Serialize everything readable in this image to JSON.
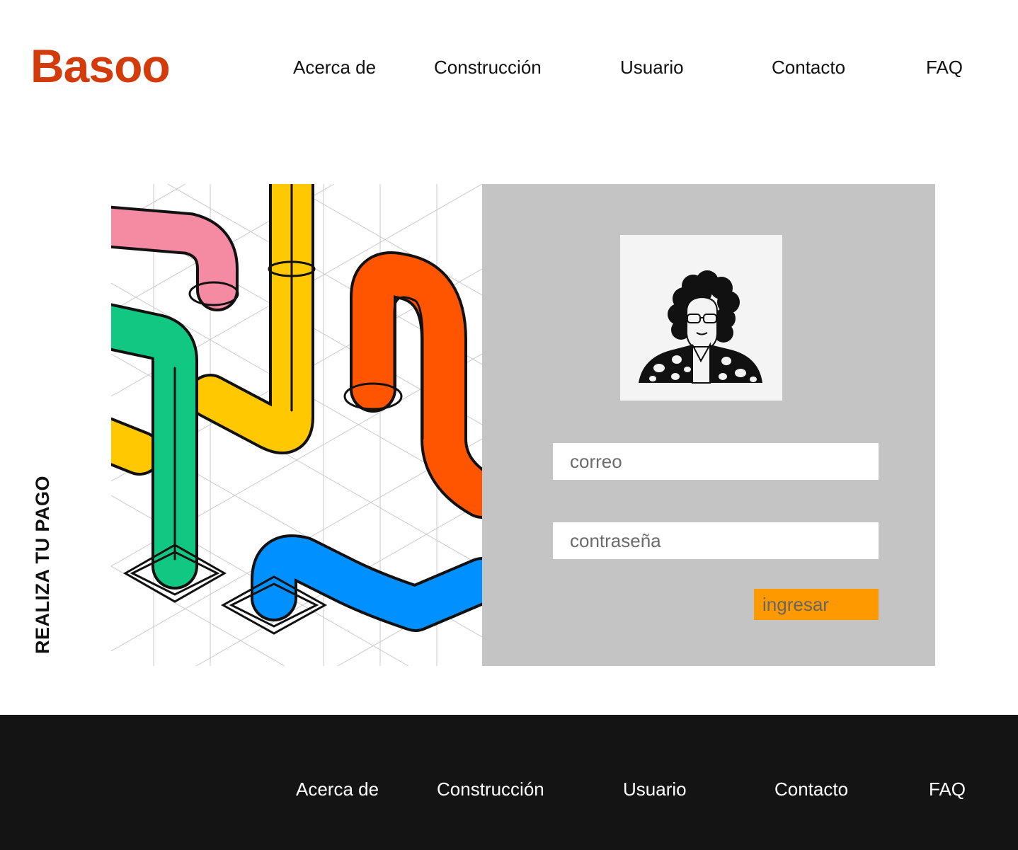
{
  "brand": {
    "name": "Basoo",
    "color": "#d43b0a"
  },
  "nav": {
    "items": [
      {
        "label": "Acerca de"
      },
      {
        "label": "Construcción"
      },
      {
        "label": "Usuario"
      },
      {
        "label": "Contacto"
      },
      {
        "label": "FAQ"
      }
    ]
  },
  "side_title": "REALIZA TU PAGO",
  "illustration": {
    "icon": "colorful-pipes-illustration"
  },
  "login": {
    "avatar_icon": "user-avatar-icon",
    "email_placeholder": "correo",
    "password_placeholder": "contraseña",
    "submit_label": "ingresar",
    "submit_color": "#ff9900",
    "panel_color": "#c4c4c4"
  },
  "footer": {
    "background": "#141414",
    "items": [
      {
        "label": "Acerca de"
      },
      {
        "label": "Construcción"
      },
      {
        "label": "Usuario"
      },
      {
        "label": "Contacto"
      },
      {
        "label": "FAQ"
      }
    ]
  }
}
